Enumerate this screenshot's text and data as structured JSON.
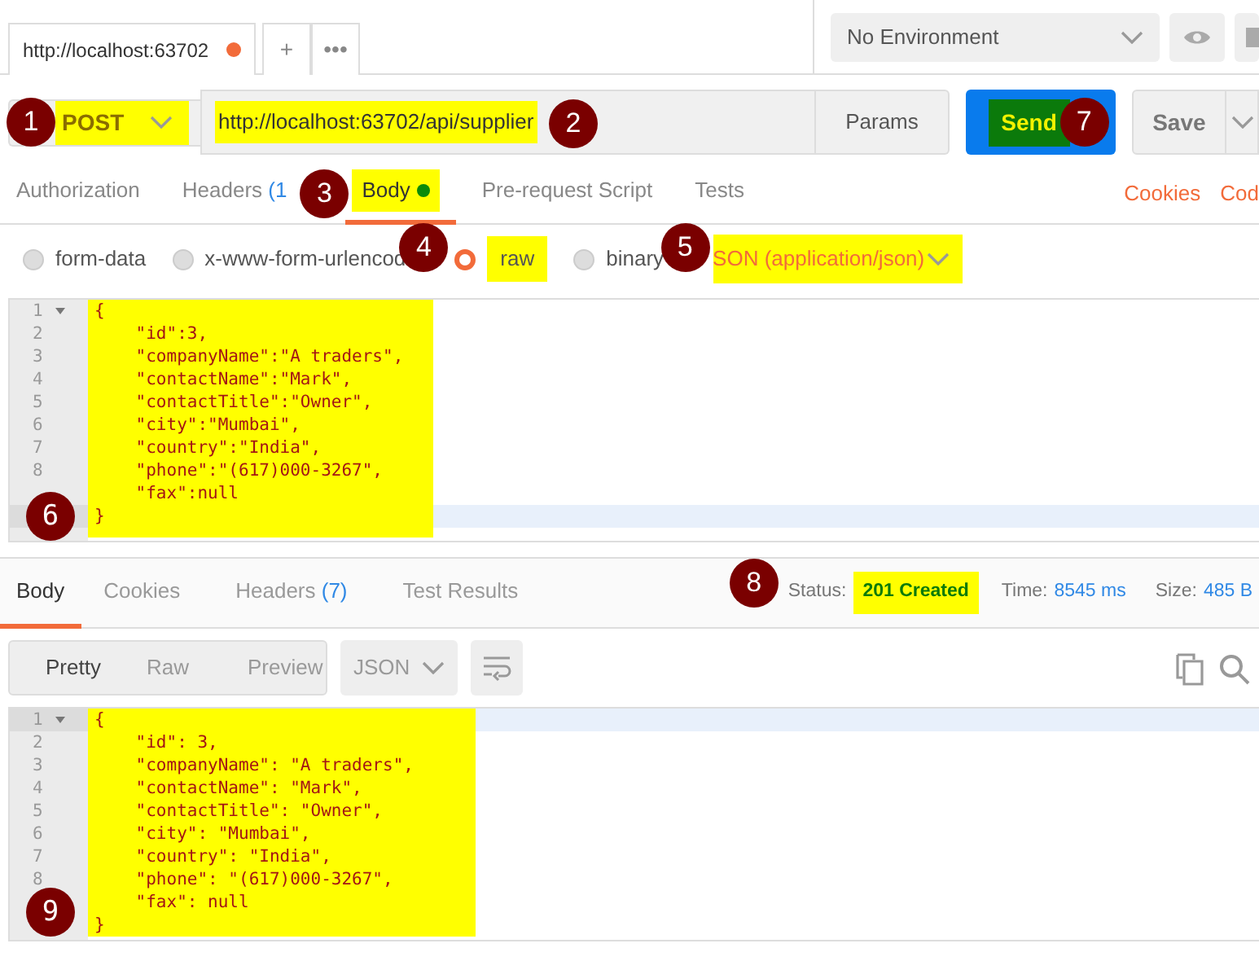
{
  "request_tabs": [
    {
      "label": "http://localhost:63702",
      "unsaved": true,
      "selected": true
    }
  ],
  "tab_actions": [
    "+",
    "•••"
  ],
  "environment": {
    "value": "No Environment"
  },
  "request": {
    "method": "POST",
    "method_marker": "1",
    "url": "http://localhost:63702/api/supplier",
    "url_marker": "2",
    "params_label": "Params",
    "send_label": "Send",
    "send_marker": "7",
    "save_label": "Save"
  },
  "request_sections": [
    {
      "label": "Authorization",
      "selected": false
    },
    {
      "label": "Headers",
      "count": "(1",
      "selected": false
    },
    {
      "label": "Body",
      "selected": true,
      "dot": true,
      "marker": "3"
    },
    {
      "label": "Pre-request Script",
      "selected": false
    },
    {
      "label": "Tests",
      "selected": false
    }
  ],
  "links": [
    "Cookies",
    "Cod"
  ],
  "body_types": [
    {
      "label": "form-data",
      "selected": false
    },
    {
      "label": "x-www-form-urlencod",
      "selected": false
    },
    {
      "label": "raw",
      "selected": true,
      "marker": "4"
    },
    {
      "label": "binary",
      "selected": false
    }
  ],
  "content_type": {
    "value": "SON (application/json)",
    "marker": "5"
  },
  "request_editor": {
    "marker": "6",
    "lines": [
      {
        "number": "1",
        "text": "{",
        "active": false,
        "foldable": true
      },
      {
        "number": "2",
        "text": "    \"id\":3,",
        "active": false
      },
      {
        "number": "3",
        "text": "    \"companyName\":\"A traders\",",
        "active": false
      },
      {
        "number": "4",
        "text": "    \"contactName\":\"Mark\",",
        "active": false
      },
      {
        "number": "5",
        "text": "    \"contactTitle\":\"Owner\",",
        "active": false
      },
      {
        "number": "6",
        "text": "    \"city\":\"Mumbai\",",
        "active": false
      },
      {
        "number": "7",
        "text": "    \"country\":\"India\",",
        "active": false
      },
      {
        "number": "8",
        "text": "    \"phone\":\"(617)000-3267\",",
        "active": false
      },
      {
        "text": "    \"fax\":null",
        "active": false
      },
      {
        "text": "}",
        "active": true
      }
    ]
  },
  "response_sections": [
    {
      "label": "Body",
      "selected": true
    },
    {
      "label": "Cookies",
      "selected": false
    },
    {
      "label": "Headers",
      "count": "(7)",
      "selected": false
    },
    {
      "label": "Test Results",
      "selected": false
    }
  ],
  "response_meta": {
    "marker": "8",
    "status_label": "Status:",
    "status": "201 Created",
    "time_label": "Time:",
    "time": "8545 ms",
    "size_label": "Size:",
    "size": "485 B"
  },
  "view_modes": [
    {
      "label": "Pretty",
      "selected": true
    },
    {
      "label": "Raw",
      "selected": false
    },
    {
      "label": "Preview",
      "selected": false
    }
  ],
  "format": "JSON",
  "response_editor": {
    "marker": "9",
    "lines": [
      {
        "number": "1",
        "text": "{",
        "active": true,
        "foldable": true
      },
      {
        "number": "2",
        "text": "    \"id\": 3,",
        "active": false
      },
      {
        "number": "3",
        "text": "    \"companyName\": \"A traders\",",
        "active": false
      },
      {
        "number": "4",
        "text": "    \"contactName\": \"Mark\",",
        "active": false
      },
      {
        "number": "5",
        "text": "    \"contactTitle\": \"Owner\",",
        "active": false
      },
      {
        "number": "6",
        "text": "    \"city\": \"Mumbai\",",
        "active": false
      },
      {
        "number": "7",
        "text": "    \"country\": \"India\",",
        "active": false
      },
      {
        "number": "8",
        "text": "    \"phone\": \"(617)000-3267\",",
        "active": false
      },
      {
        "text": "    \"fax\": null",
        "active": false
      },
      {
        "text": "}",
        "active": false
      }
    ]
  }
}
